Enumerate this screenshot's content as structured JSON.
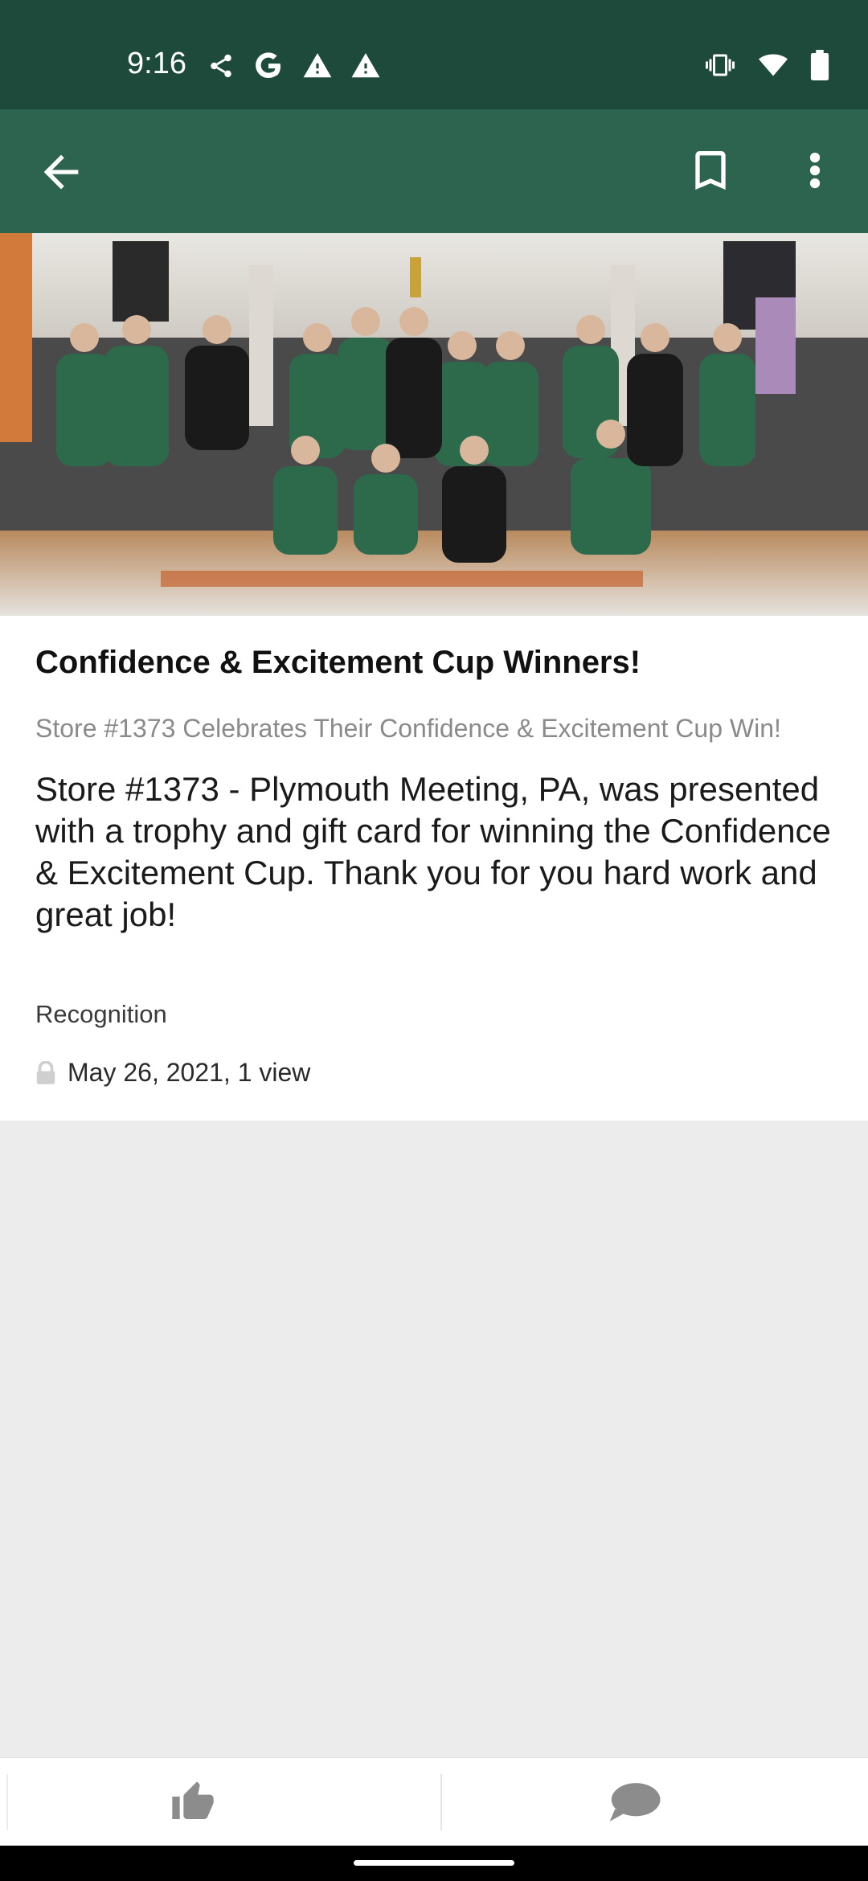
{
  "status_bar": {
    "time": "9:16",
    "left_icons": [
      "share-icon",
      "google-g-icon",
      "warning-icon",
      "warning-icon"
    ],
    "right_icons": [
      "vibrate-icon",
      "wifi-icon",
      "battery-icon"
    ]
  },
  "app_bar": {
    "back_icon": "arrow-left-icon",
    "bookmark_icon": "bookmark-icon",
    "more_icon": "more-vert-icon"
  },
  "article": {
    "image": "Group photo of store team celebrating with a trophy",
    "title": "Confidence & Excitement Cup Winners!",
    "subtitle": "Store #1373 Celebrates Their Confidence & Excitement Cup Win!",
    "body": "Store #1373 - Plymouth Meeting, PA, was presented with a trophy and gift card for winning the Confidence & Excitement Cup. Thank you for you hard work and great job!",
    "category": "Recognition",
    "meta": "May 26, 2021, 1 view",
    "meta_icon": "lock-icon"
  },
  "bottom_bar": {
    "like_icon": "thumbs-up-icon",
    "comment_icon": "comment-icon"
  },
  "colors": {
    "status_bar": "#1e4a3b",
    "app_bar": "#2c6450",
    "page_background": "#ececec",
    "card_background": "#ffffff"
  }
}
